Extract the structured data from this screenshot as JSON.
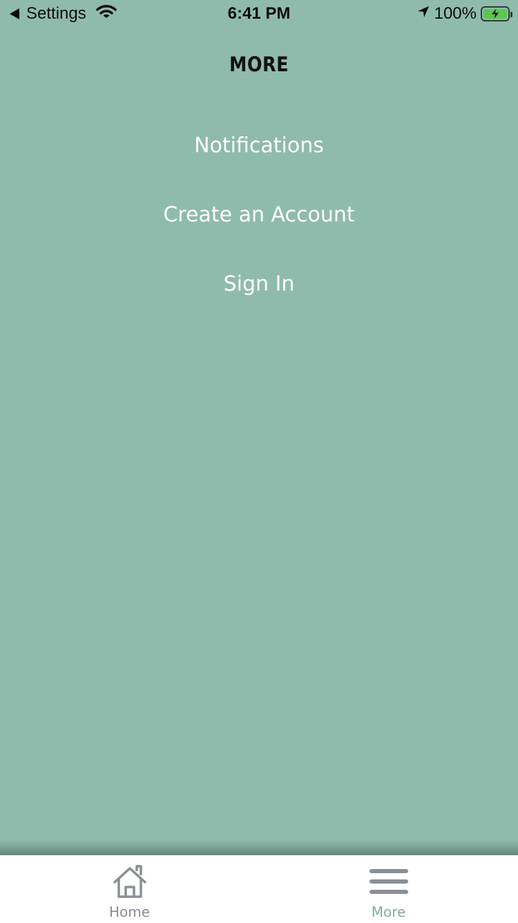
{
  "status_bar": {
    "back_label": "Settings",
    "time": "6:41 PM",
    "battery_percent": "100%",
    "battery_level": 1.0,
    "icons": [
      "back-arrow-icon",
      "wifi-icon",
      "location-arrow-icon",
      "battery-charging-icon"
    ]
  },
  "header": {
    "title": "MORE"
  },
  "menu": {
    "items": [
      {
        "label": "Notifications"
      },
      {
        "label": "Create an Account"
      },
      {
        "label": "Sign In"
      }
    ]
  },
  "tab_bar": {
    "tabs": [
      {
        "label": "Home",
        "icon": "home-icon",
        "selected": false
      },
      {
        "label": "More",
        "icon": "menu-icon",
        "selected": true
      }
    ]
  },
  "colors": {
    "background": "#8fbbac",
    "menu_text": "#ffffff",
    "tab_inactive": "#8a8f96",
    "tab_active_label": "#7fae9c",
    "battery_fill": "#5ac84f"
  }
}
